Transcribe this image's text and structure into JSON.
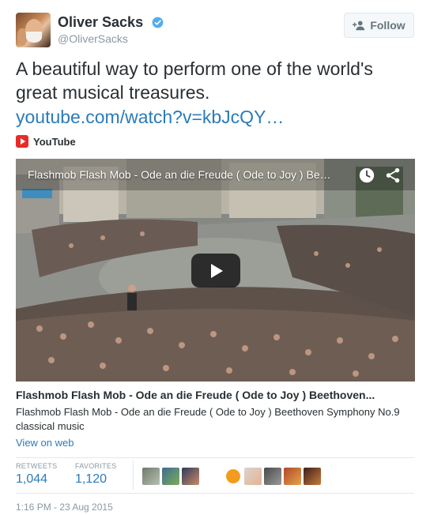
{
  "user": {
    "name": "Oliver Sacks",
    "handle": "@OliverSacks",
    "follow_label": "Follow"
  },
  "tweet": {
    "text": "A beautiful way to perform one of the world's great musical treasures.",
    "link": "youtube.com/watch?v=kbJcQY…"
  },
  "source": {
    "label": "YouTube"
  },
  "card": {
    "video_title": "Flashmob Flash Mob - Ode an die Freude ( Ode to Joy ) Be…",
    "title": "Flashmob Flash Mob - Ode an die Freude ( Ode to Joy ) Beethoven...",
    "description": "Flashmob Flash Mob - Ode an die Freude ( Ode to Joy ) Beethoven Symphony No.9 classical music",
    "view_on_web": "View on web"
  },
  "stats": {
    "retweets_label": "RETWEETS",
    "retweets_count": "1,044",
    "favorites_label": "FAVORITES",
    "favorites_count": "1,120"
  },
  "timestamp": "1:16 PM - 23 Aug 2015",
  "colors": {
    "link": "#2b7bb9",
    "verified": "#55acee",
    "youtube_red": "#e52d27",
    "muted": "#8899a6"
  },
  "icons": [
    "verified-icon",
    "follow-person-icon",
    "youtube-icon",
    "clock-icon",
    "share-icon",
    "play-icon"
  ]
}
